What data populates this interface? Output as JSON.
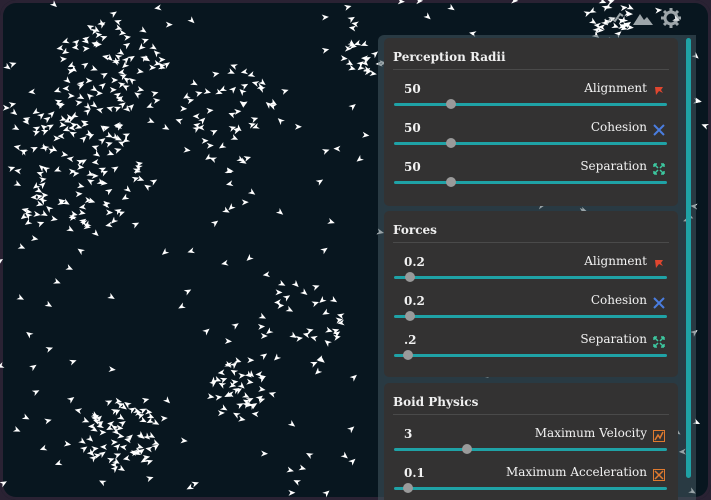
{
  "colors": {
    "background": "#08161f",
    "boid": "#ffffff",
    "accent": "#1fa2a6",
    "panel": "#333232",
    "alignment_icon": "#e0462f",
    "cohesion_icon": "#4a7de0",
    "separation_icon": "#3cc8a0",
    "physics_icon": "#e07a2f"
  },
  "toolbar": {
    "icons": [
      "chart-icon",
      "mountain-icon",
      "gear-icon"
    ]
  },
  "perception": {
    "title": "Perception Radii",
    "rows": [
      {
        "value": "50",
        "label": "Alignment",
        "icon": "alignment-icon",
        "fraction": 0.21
      },
      {
        "value": "50",
        "label": "Cohesion",
        "icon": "cohesion-icon",
        "fraction": 0.21
      },
      {
        "value": "50",
        "label": "Separation",
        "icon": "separation-icon",
        "fraction": 0.21
      }
    ]
  },
  "forces": {
    "title": "Forces",
    "rows": [
      {
        "value": "0.2",
        "label": "Alignment",
        "icon": "alignment-icon",
        "fraction": 0.06
      },
      {
        "value": "0.2",
        "label": "Cohesion",
        "icon": "cohesion-icon",
        "fraction": 0.06
      },
      {
        "value": ".2",
        "label": "Separation",
        "icon": "separation-icon",
        "fraction": 0.05
      }
    ]
  },
  "physics": {
    "title": "Boid Physics",
    "rows": [
      {
        "value": "3",
        "label": "Maximum Velocity",
        "icon": "velocity-icon",
        "fraction": 0.27
      },
      {
        "value": "0.1",
        "label": "Maximum Acceleration",
        "icon": "acceleration-icon",
        "fraction": 0.05
      }
    ]
  }
}
